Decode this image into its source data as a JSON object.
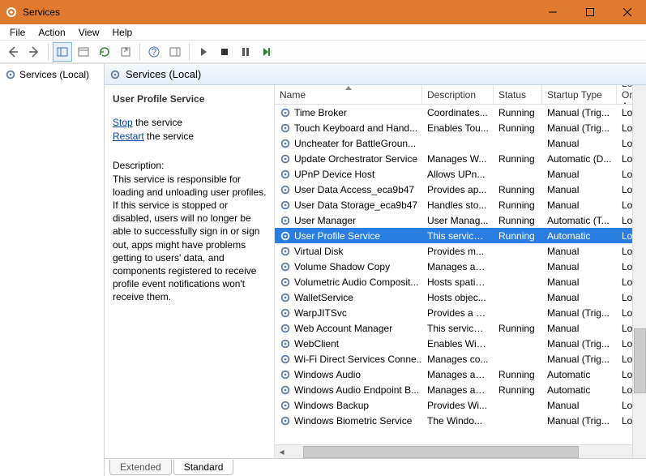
{
  "window": {
    "title": "Services"
  },
  "menu": {
    "file": "File",
    "action": "Action",
    "view": "View",
    "help": "Help"
  },
  "tree": {
    "root": "Services (Local)"
  },
  "pane": {
    "title": "Services (Local)"
  },
  "detail": {
    "service_name": "User Profile Service",
    "stop_link": "Stop",
    "stop_suffix": " the service",
    "restart_link": "Restart",
    "restart_suffix": " the service",
    "desc_label": "Description:",
    "desc_text": "This service is responsible for loading and unloading user profiles. If this service is stopped or disabled, users will no longer be able to successfully sign in or sign out, apps might have problems getting to users' data, and components registered to receive profile event notifications won't receive them."
  },
  "columns": {
    "name": "Name",
    "description": "Description",
    "status": "Status",
    "startup": "Startup Type",
    "logon": "Log On As"
  },
  "rows": [
    {
      "name": "Time Broker",
      "desc": "Coordinates...",
      "status": "Running",
      "startup": "Manual (Trig...",
      "logon": "Loc"
    },
    {
      "name": "Touch Keyboard and Hand...",
      "desc": "Enables Tou...",
      "status": "Running",
      "startup": "Manual (Trig...",
      "logon": "Loc"
    },
    {
      "name": "Uncheater for BattleGroun...",
      "desc": "",
      "status": "",
      "startup": "Manual",
      "logon": "Loc"
    },
    {
      "name": "Update Orchestrator Service",
      "desc": "Manages W...",
      "status": "Running",
      "startup": "Automatic (D...",
      "logon": "Loc"
    },
    {
      "name": "UPnP Device Host",
      "desc": "Allows UPn...",
      "status": "",
      "startup": "Manual",
      "logon": "Loc"
    },
    {
      "name": "User Data Access_eca9b47",
      "desc": "Provides ap...",
      "status": "Running",
      "startup": "Manual",
      "logon": "Loc"
    },
    {
      "name": "User Data Storage_eca9b47",
      "desc": "Handles sto...",
      "status": "Running",
      "startup": "Manual",
      "logon": "Loc"
    },
    {
      "name": "User Manager",
      "desc": "User Manag...",
      "status": "Running",
      "startup": "Automatic (T...",
      "logon": "Loc"
    },
    {
      "name": "User Profile Service",
      "desc": "This service ...",
      "status": "Running",
      "startup": "Automatic",
      "logon": "Loc",
      "selected": true
    },
    {
      "name": "Virtual Disk",
      "desc": "Provides m...",
      "status": "",
      "startup": "Manual",
      "logon": "Loc"
    },
    {
      "name": "Volume Shadow Copy",
      "desc": "Manages an...",
      "status": "",
      "startup": "Manual",
      "logon": "Loc"
    },
    {
      "name": "Volumetric Audio Composit...",
      "desc": "Hosts spatia...",
      "status": "",
      "startup": "Manual",
      "logon": "Loc"
    },
    {
      "name": "WalletService",
      "desc": "Hosts objec...",
      "status": "",
      "startup": "Manual",
      "logon": "Loc"
    },
    {
      "name": "WarpJITSvc",
      "desc": "Provides a JI...",
      "status": "",
      "startup": "Manual (Trig...",
      "logon": "Loc"
    },
    {
      "name": "Web Account Manager",
      "desc": "This service ...",
      "status": "Running",
      "startup": "Manual",
      "logon": "Loc"
    },
    {
      "name": "WebClient",
      "desc": "Enables Win...",
      "status": "",
      "startup": "Manual (Trig...",
      "logon": "Loc"
    },
    {
      "name": "Wi-Fi Direct Services Conne...",
      "desc": "Manages co...",
      "status": "",
      "startup": "Manual (Trig...",
      "logon": "Loc"
    },
    {
      "name": "Windows Audio",
      "desc": "Manages au...",
      "status": "Running",
      "startup": "Automatic",
      "logon": "Loc"
    },
    {
      "name": "Windows Audio Endpoint B...",
      "desc": "Manages au...",
      "status": "Running",
      "startup": "Automatic",
      "logon": "Loc"
    },
    {
      "name": "Windows Backup",
      "desc": "Provides Wi...",
      "status": "",
      "startup": "Manual",
      "logon": "Loc"
    },
    {
      "name": "Windows Biometric Service",
      "desc": "The Windo...",
      "status": "",
      "startup": "Manual (Trig...",
      "logon": "Loc"
    }
  ],
  "tabs": {
    "extended": "Extended",
    "standard": "Standard"
  }
}
